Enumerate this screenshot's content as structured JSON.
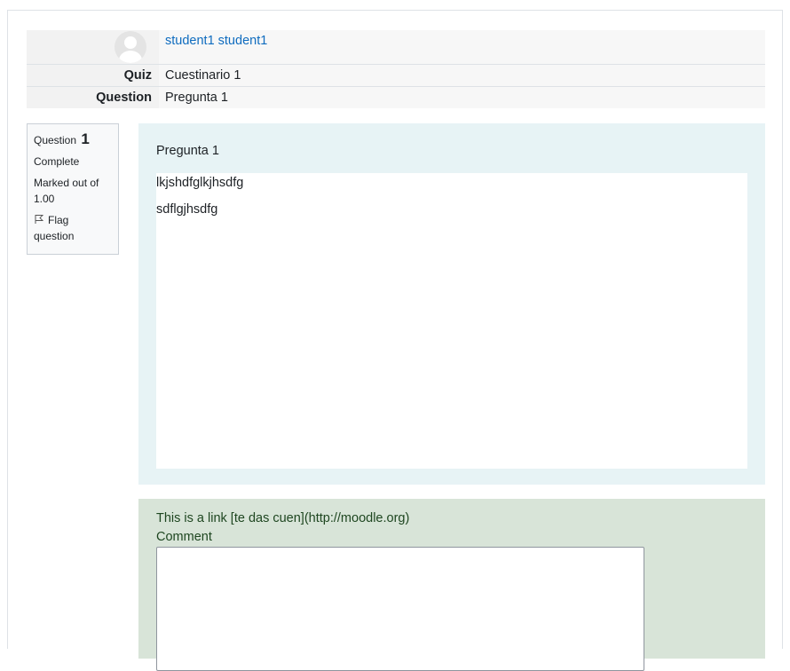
{
  "summary": {
    "user_name": "student1 student1",
    "rows": [
      {
        "label": "Quiz",
        "value": "Cuestinario 1"
      },
      {
        "label": "Question",
        "value": "Pregunta 1"
      }
    ]
  },
  "qinfo": {
    "question_label": "Question",
    "question_number": "1",
    "state": "Complete",
    "grade": "Marked out of 1.00",
    "flag_label": "Flag question"
  },
  "question": {
    "text": "Pregunta 1",
    "answer_lines": [
      "lkjshdfglkjhsdfg",
      "sdflgjhsdfg"
    ]
  },
  "comment": {
    "previous_text": "This is a link [te das cuen](http://moodle.org)",
    "label": "Comment",
    "value": ""
  },
  "colors": {
    "link": "#0f6cbf",
    "formulation_bg": "#e7f3f5",
    "comment_bg": "#d8e4d8"
  }
}
